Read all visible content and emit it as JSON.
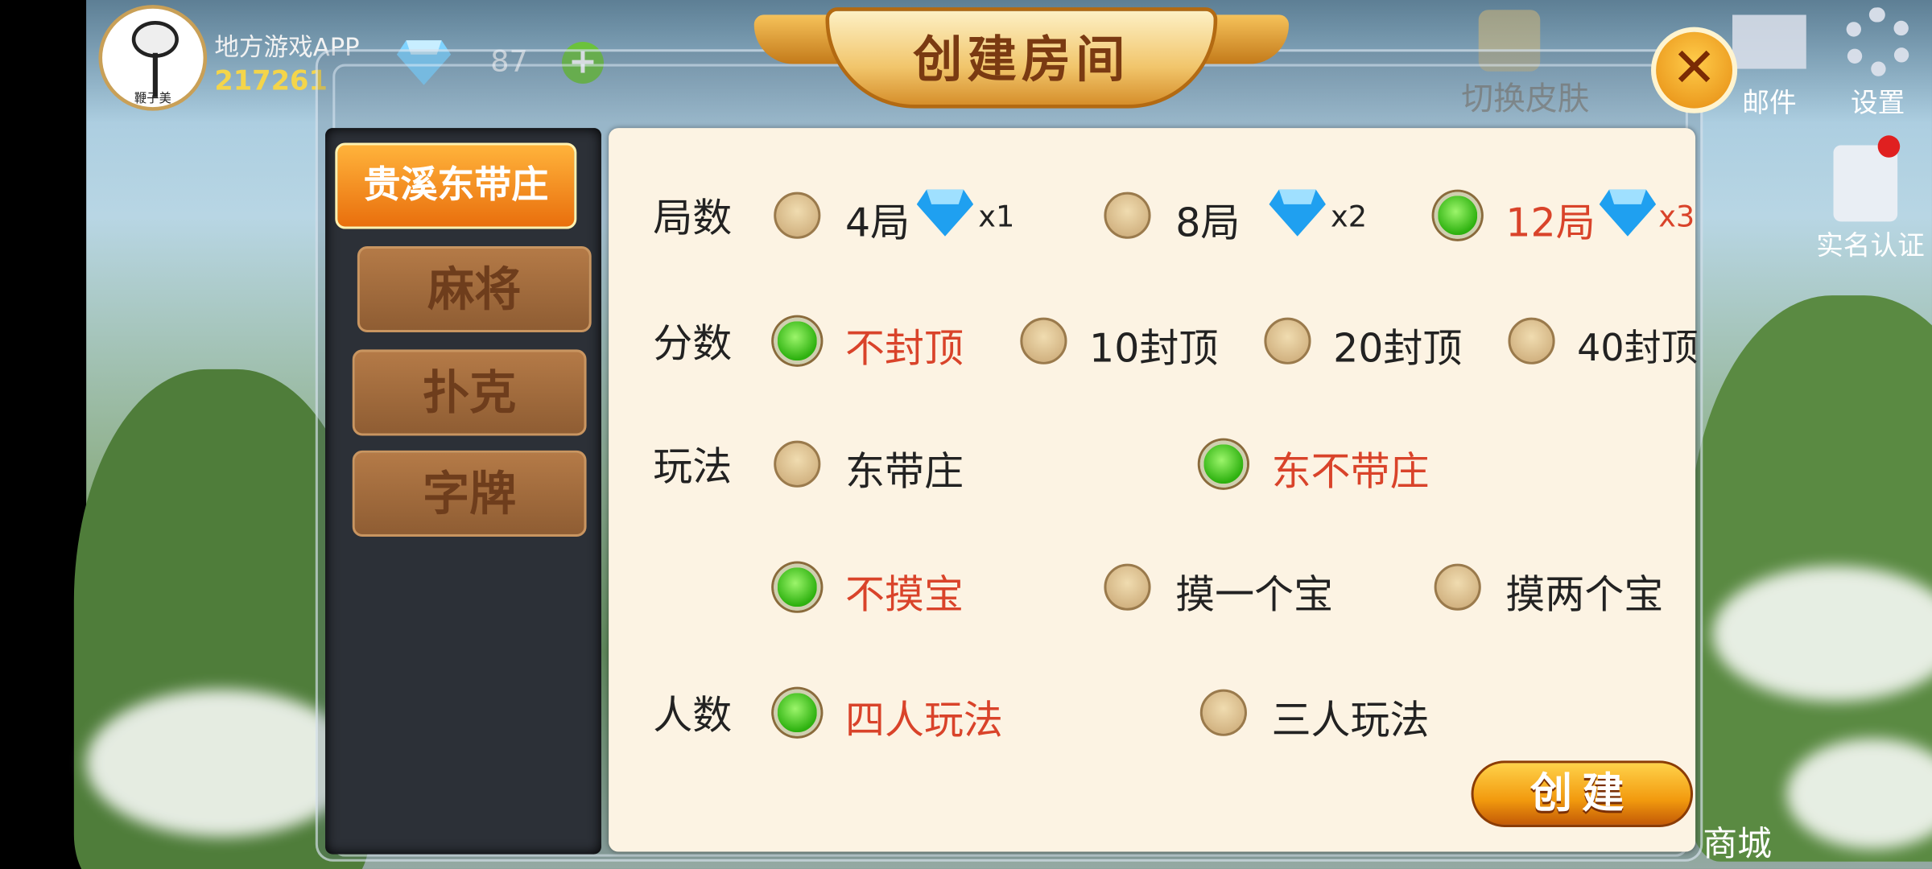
{
  "header": {
    "app_name": "地方游戏APP",
    "player_id": "217261",
    "avatar_caption": "鞭子美",
    "gems": "87",
    "skin_label": "切换皮肤",
    "mail_label": "邮件",
    "settings_label": "设置",
    "realname_label": "实名认证",
    "shop_label": "商城",
    "rules_label": "玩法"
  },
  "dialog": {
    "title": "创建房间",
    "close_glyph": "✕",
    "tabs": [
      {
        "label": "贵溪东带庄",
        "active": true
      },
      {
        "label": "麻将",
        "active": false
      },
      {
        "label": "扑克",
        "active": false
      },
      {
        "label": "字牌",
        "active": false
      }
    ],
    "rows": {
      "rounds": {
        "label": "局数",
        "options": [
          {
            "text": "4局",
            "mult": "x1",
            "selected": false
          },
          {
            "text": "8局",
            "mult": "x2",
            "selected": false
          },
          {
            "text": "12局",
            "mult": "x3",
            "selected": true
          }
        ]
      },
      "score": {
        "label": "分数",
        "options": [
          {
            "text": "不封顶",
            "selected": true
          },
          {
            "text": "10封顶",
            "selected": false
          },
          {
            "text": "20封顶",
            "selected": false
          },
          {
            "text": "40封顶",
            "selected": false
          }
        ]
      },
      "mode": {
        "label": "玩法",
        "options": [
          {
            "text": "东带庄",
            "selected": false
          },
          {
            "text": "东不带庄",
            "selected": true
          }
        ]
      },
      "treasure": {
        "options": [
          {
            "text": "不摸宝",
            "selected": true
          },
          {
            "text": "摸一个宝",
            "selected": false
          },
          {
            "text": "摸两个宝",
            "selected": false
          }
        ]
      },
      "players": {
        "label": "人数",
        "options": [
          {
            "text": "四人玩法",
            "selected": true
          },
          {
            "text": "三人玩法",
            "selected": false
          }
        ]
      }
    },
    "create_label": "创建"
  },
  "colors": {
    "selected_text": "#d9432a",
    "accent_orange": "#f29a0e",
    "panel_bg": "#fcf3e3"
  }
}
